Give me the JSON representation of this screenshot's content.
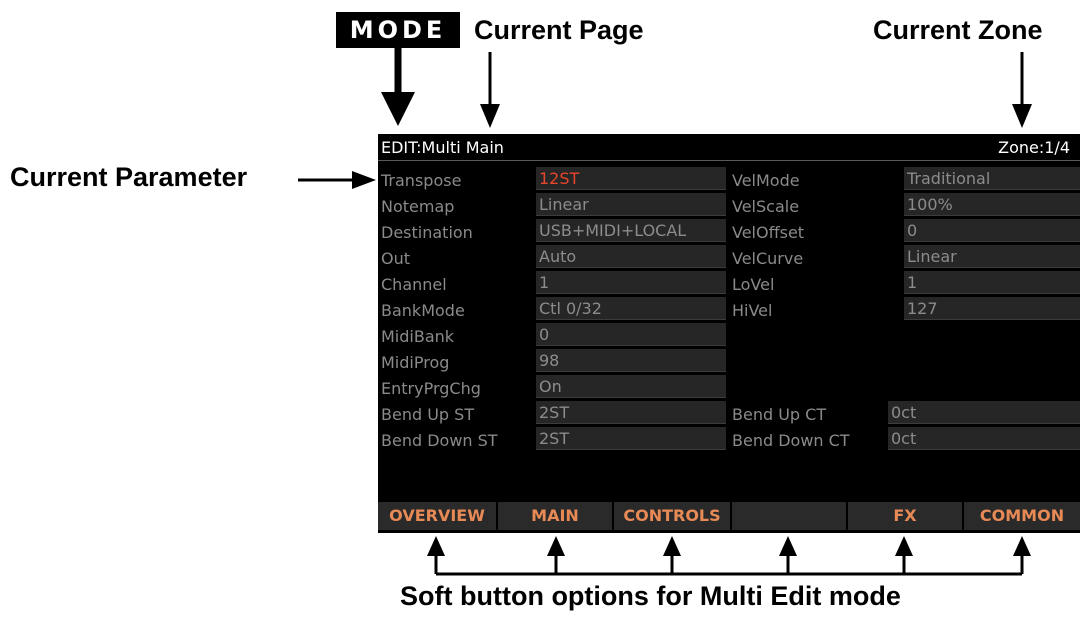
{
  "callouts": {
    "mode": "MODE",
    "current_page": "Current Page",
    "current_zone": "Current Zone",
    "current_parameter": "Current Parameter",
    "soft_buttons": "Soft button options for Multi Edit mode"
  },
  "screen": {
    "title": "EDIT:Multi Main",
    "zone": "Zone:1/4",
    "left_params": [
      {
        "label": "Transpose",
        "value": "12ST"
      },
      {
        "label": "Notemap",
        "value": "Linear"
      },
      {
        "label": "Destination",
        "value": "USB+MIDI+LOCAL"
      },
      {
        "label": "Out",
        "value": "Auto"
      },
      {
        "label": "Channel",
        "value": "1"
      },
      {
        "label": "BankMode",
        "value": "Ctl 0/32"
      },
      {
        "label": "MidiBank",
        "value": "0"
      },
      {
        "label": "MidiProg",
        "value": "98"
      },
      {
        "label": "EntryPrgChg",
        "value": "On"
      },
      {
        "label": "Bend Up ST",
        "value": "2ST"
      },
      {
        "label": "Bend Down ST",
        "value": "2ST"
      }
    ],
    "right_params": [
      {
        "label": "VelMode",
        "value": "Traditional"
      },
      {
        "label": "VelScale",
        "value": "100%"
      },
      {
        "label": "VelOffset",
        "value": "0"
      },
      {
        "label": "VelCurve",
        "value": "Linear"
      },
      {
        "label": "LoVel",
        "value": "1"
      },
      {
        "label": "HiVel",
        "value": "127"
      }
    ],
    "bend_ct": [
      {
        "label": "Bend Up CT",
        "value": "0ct"
      },
      {
        "label": "Bend Down CT",
        "value": "0ct"
      }
    ],
    "soft_buttons": [
      "OVERVIEW",
      "MAIN",
      "CONTROLS",
      "",
      "FX",
      "COMMON"
    ],
    "colors": {
      "background": "#000000",
      "active_value": "#e8462a",
      "soft_button_text": "#e88a56",
      "label_text": "#8a8a8a"
    }
  }
}
